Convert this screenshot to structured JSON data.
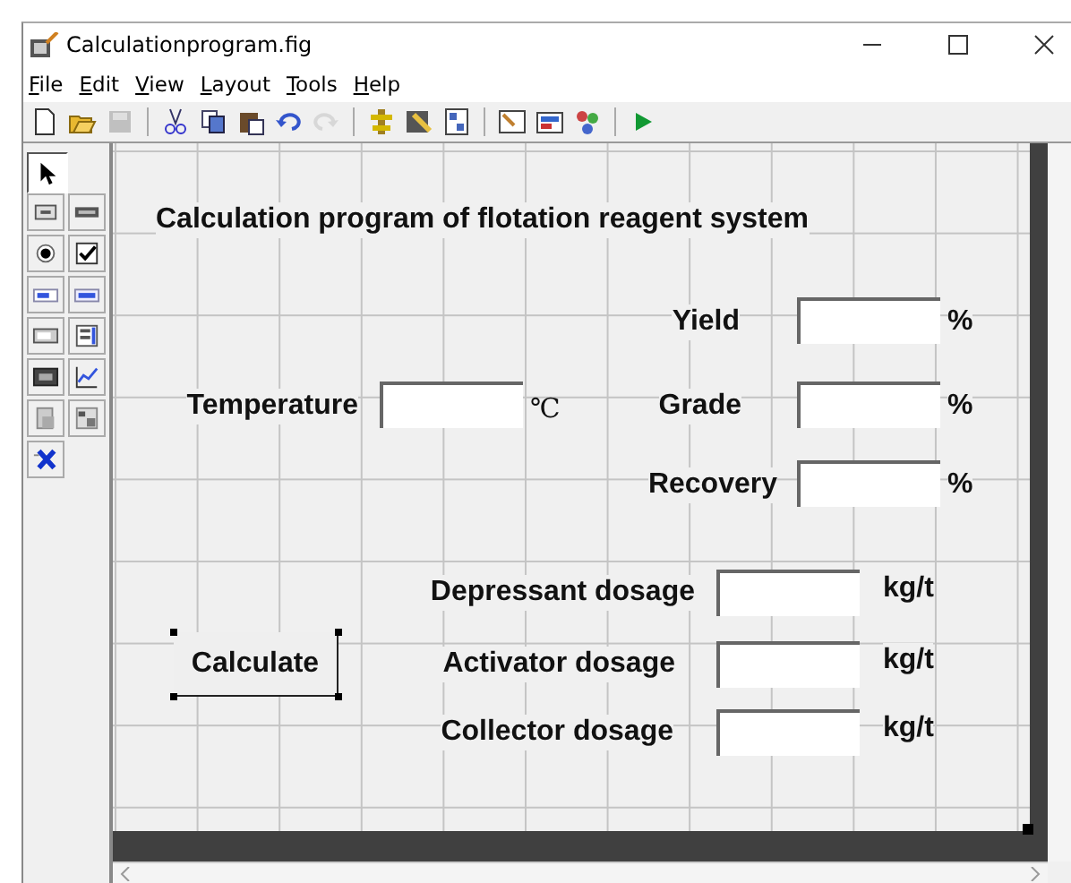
{
  "window": {
    "title": "Calculationprogram.fig"
  },
  "menu": [
    "File",
    "Edit",
    "View",
    "Layout",
    "Tools",
    "Help"
  ],
  "toolbar": [
    {
      "disabled": false
    },
    {
      "disabled": false
    },
    {
      "disabled": true
    },
    {
      "disabled": false
    },
    {
      "disabled": false
    },
    {
      "disabled": false
    },
    {
      "disabled": false
    },
    {
      "disabled": true
    },
    {
      "disabled": false
    },
    {
      "disabled": false
    },
    {
      "disabled": false
    },
    {
      "disabled": false
    },
    {
      "disabled": false
    },
    {
      "disabled": false
    },
    {
      "disabled": false
    }
  ],
  "palette": [
    {
      "selected": true
    },
    {
      "selected": false
    },
    {
      "selected": false
    },
    {
      "selected": false
    },
    {
      "selected": false
    },
    {
      "selected": false
    },
    {
      "selected": false
    },
    {
      "selected": false
    },
    {
      "selected": false
    },
    {
      "selected": false
    },
    {
      "selected": false
    },
    {
      "selected": false
    },
    {
      "selected": false
    },
    {
      "selected": false
    }
  ],
  "figure": {
    "heading": "Calculation program of flotation reagent system",
    "temperature": {
      "label": "Temperature",
      "unit": "℃"
    },
    "results": [
      {
        "label": "Yield",
        "unit": "%"
      },
      {
        "label": "Grade",
        "unit": "%"
      },
      {
        "label": "Recovery",
        "unit": "%"
      }
    ],
    "calculate": {
      "label": "Calculate",
      "selected": true
    },
    "dosages": [
      {
        "label": "Depressant dosage",
        "unit": "kg/t"
      },
      {
        "label": "Activator dosage",
        "unit": "kg/t"
      },
      {
        "label": "Collector dosage",
        "unit": "kg/t"
      }
    ]
  }
}
